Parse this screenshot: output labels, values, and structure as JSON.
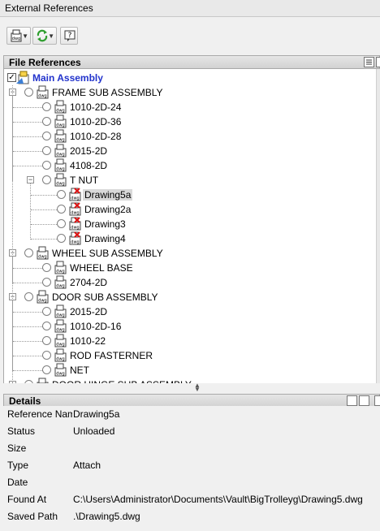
{
  "title": "External References",
  "toolbar": {
    "attach_icon": "attach-dwg-icon",
    "refresh_icon": "refresh-icon",
    "help_icon": "help-icon",
    "help_glyph": "?"
  },
  "file_references": {
    "header": "File References",
    "nodes": [
      {
        "label": "Main Assembly",
        "level": 0,
        "kind": "main",
        "expand": ""
      },
      {
        "label": "FRAME SUB ASSEMBLY",
        "level": 1,
        "kind": "dwg",
        "expand": "−"
      },
      {
        "label": "1010-2D-24",
        "level": 2,
        "kind": "dwg",
        "expand": ""
      },
      {
        "label": "1010-2D-36",
        "level": 2,
        "kind": "dwg",
        "expand": ""
      },
      {
        "label": "1010-2D-28",
        "level": 2,
        "kind": "dwg",
        "expand": ""
      },
      {
        "label": "2015-2D",
        "level": 2,
        "kind": "dwg",
        "expand": ""
      },
      {
        "label": "4108-2D",
        "level": 2,
        "kind": "dwg",
        "expand": ""
      },
      {
        "label": "T NUT",
        "level": 2,
        "kind": "dwg",
        "expand": "−"
      },
      {
        "label": "Drawing5a",
        "level": 3,
        "kind": "unloaded",
        "expand": "",
        "selected": true
      },
      {
        "label": "Drawing2a",
        "level": 3,
        "kind": "unloaded",
        "expand": ""
      },
      {
        "label": "Drawing3",
        "level": 3,
        "kind": "unloaded",
        "expand": ""
      },
      {
        "label": "Drawing4",
        "level": 3,
        "kind": "unloaded",
        "expand": ""
      },
      {
        "label": "WHEEL SUB ASSEMBLY",
        "level": 1,
        "kind": "dwg",
        "expand": "−"
      },
      {
        "label": "WHEEL BASE",
        "level": 2,
        "kind": "dwg",
        "expand": ""
      },
      {
        "label": "2704-2D",
        "level": 2,
        "kind": "dwg",
        "expand": ""
      },
      {
        "label": "DOOR SUB ASSEMBLY",
        "level": 1,
        "kind": "dwg",
        "expand": "−"
      },
      {
        "label": "2015-2D",
        "level": 2,
        "kind": "dwg",
        "expand": ""
      },
      {
        "label": "1010-2D-16",
        "level": 2,
        "kind": "dwg",
        "expand": ""
      },
      {
        "label": "1010-22",
        "level": 2,
        "kind": "dwg",
        "expand": ""
      },
      {
        "label": "ROD FASTERNER",
        "level": 2,
        "kind": "dwg",
        "expand": ""
      },
      {
        "label": "NET",
        "level": 2,
        "kind": "dwg",
        "expand": ""
      },
      {
        "label": "DOOR HINGE SUB ASSEMBLY",
        "level": 1,
        "kind": "dwg",
        "expand": "+"
      }
    ]
  },
  "details": {
    "header": "Details",
    "rows": [
      {
        "key": "Reference Name",
        "value": "Drawing5a"
      },
      {
        "key": "Status",
        "value": "Unloaded"
      },
      {
        "key": "Size",
        "value": ""
      },
      {
        "key": "Type",
        "value": "Attach"
      },
      {
        "key": "Date",
        "value": ""
      },
      {
        "key": "Found At",
        "value": "C:\\Users\\Administrator\\Documents\\Vault\\BigTrolleyg\\Drawing5.dwg"
      },
      {
        "key": "Saved Path",
        "value": ".\\Drawing5.dwg"
      }
    ]
  },
  "colors": {
    "main_label": "#2233cc",
    "unloaded_x": "#dd1111",
    "refresh": "#2f9e2f"
  }
}
